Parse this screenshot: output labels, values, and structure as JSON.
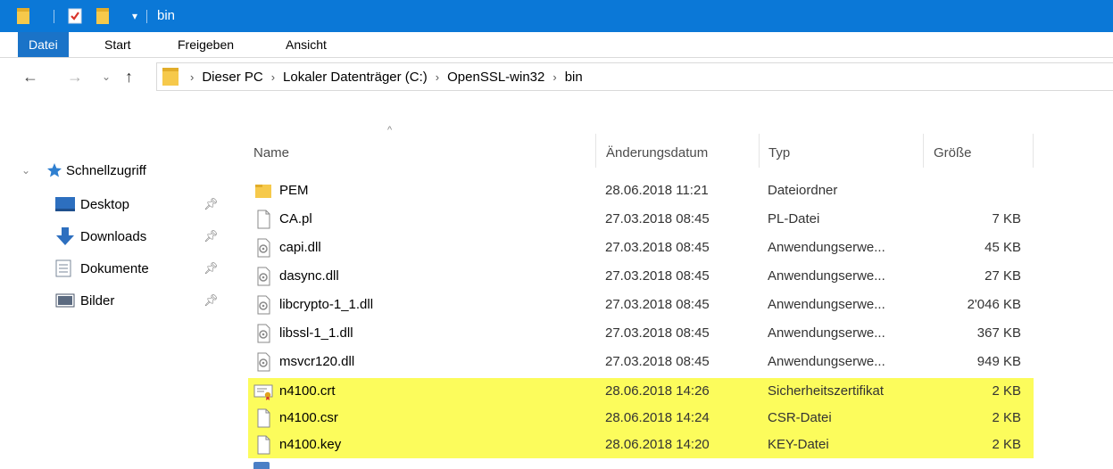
{
  "window": {
    "title": "bin"
  },
  "ribbon": {
    "tabs": [
      "Datei",
      "Start",
      "Freigeben",
      "Ansicht"
    ]
  },
  "address": {
    "crumbs": [
      "Dieser PC",
      "Lokaler Datenträger (C:)",
      "OpenSSL-win32",
      "bin"
    ]
  },
  "sidebar": {
    "section": "Schnellzugriff",
    "items": [
      {
        "label": "Desktop",
        "icon": "desktop-icon"
      },
      {
        "label": "Downloads",
        "icon": "downloads-icon"
      },
      {
        "label": "Dokumente",
        "icon": "documents-icon"
      },
      {
        "label": "Bilder",
        "icon": "pictures-icon"
      }
    ]
  },
  "columns": {
    "name": "Name",
    "date": "Änderungsdatum",
    "type": "Typ",
    "size": "Größe"
  },
  "files": [
    {
      "name": "PEM",
      "date": "28.06.2018 11:21",
      "type": "Dateiordner",
      "size": "",
      "icon": "folder-icon",
      "highlighted": false
    },
    {
      "name": "CA.pl",
      "date": "27.03.2018 08:45",
      "type": "PL-Datei",
      "size": "7 KB",
      "icon": "file-icon",
      "highlighted": false
    },
    {
      "name": "capi.dll",
      "date": "27.03.2018 08:45",
      "type": "Anwendungserwe...",
      "size": "45 KB",
      "icon": "dll-icon",
      "highlighted": false
    },
    {
      "name": "dasync.dll",
      "date": "27.03.2018 08:45",
      "type": "Anwendungserwe...",
      "size": "27 KB",
      "icon": "dll-icon",
      "highlighted": false
    },
    {
      "name": "libcrypto-1_1.dll",
      "date": "27.03.2018 08:45",
      "type": "Anwendungserwe...",
      "size": "2'046 KB",
      "icon": "dll-icon",
      "highlighted": false
    },
    {
      "name": "libssl-1_1.dll",
      "date": "27.03.2018 08:45",
      "type": "Anwendungserwe...",
      "size": "367 KB",
      "icon": "dll-icon",
      "highlighted": false
    },
    {
      "name": "msvcr120.dll",
      "date": "27.03.2018 08:45",
      "type": "Anwendungserwe...",
      "size": "949 KB",
      "icon": "dll-icon",
      "highlighted": false
    },
    {
      "name": "n4100.crt",
      "date": "28.06.2018 14:26",
      "type": "Sicherheitszertifikat",
      "size": "2 KB",
      "icon": "certificate-icon",
      "highlighted": true
    },
    {
      "name": "n4100.csr",
      "date": "28.06.2018 14:24",
      "type": "CSR-Datei",
      "size": "2 KB",
      "icon": "file-icon",
      "highlighted": true
    },
    {
      "name": "n4100.key",
      "date": "28.06.2018 14:20",
      "type": "KEY-Datei",
      "size": "2 KB",
      "icon": "file-icon",
      "highlighted": true
    }
  ],
  "colors": {
    "titlebar": "#0b78d7",
    "active_tab": "#1a73c8",
    "highlight": "#fcfc5c",
    "folder": "#f6c94b"
  }
}
